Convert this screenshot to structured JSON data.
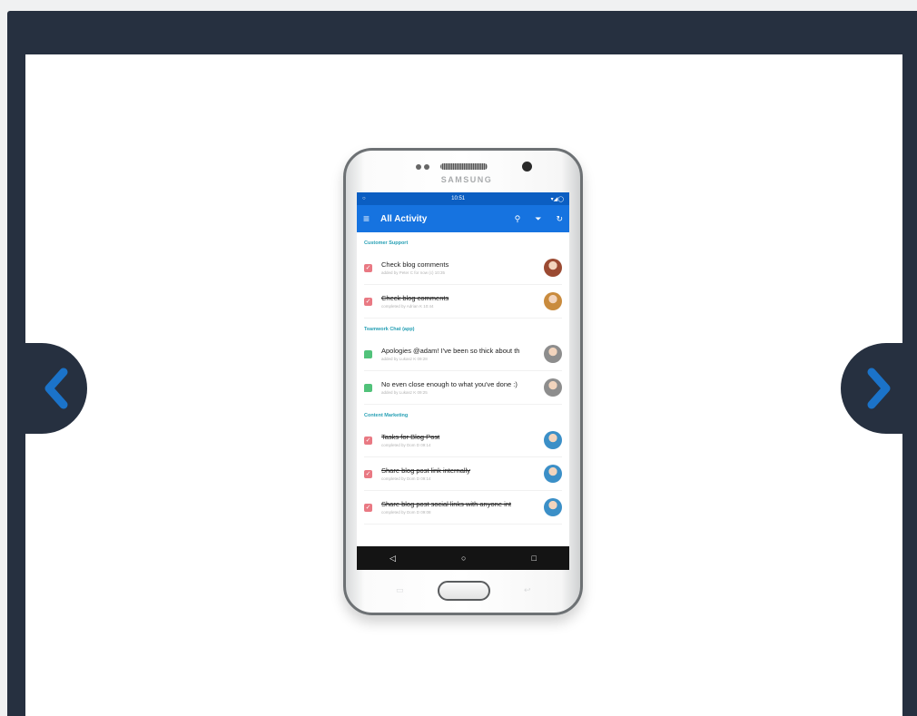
{
  "nav": {
    "prev_icon": "chevron-left-icon",
    "next_icon": "chevron-right-icon"
  },
  "colors": {
    "frame": "#263040",
    "arrow": "#1b73c9",
    "appbar": "#1673e0",
    "section": "#27a0b5"
  },
  "phone": {
    "brand": "SAMSUNG",
    "status": {
      "time": "10:51",
      "icons": "▾◢◯"
    },
    "appbar": {
      "title": "All Activity",
      "menu_icon": "≡",
      "search_icon": "⚲",
      "filter_icon": "⏷",
      "refresh_icon": "↻"
    },
    "sections": [
      {
        "title": "Customer Support",
        "items": [
          {
            "kind": "task",
            "title": "Check blog comments",
            "meta": "added by Peter C for now (c) 10:35",
            "done": false,
            "avatar_color": "#9b4a32"
          },
          {
            "kind": "task",
            "title": "Check blog comments",
            "meta": "completed by Adrian K 10:44",
            "done": true,
            "avatar_color": "#c98b3d"
          }
        ]
      },
      {
        "title": "Teamwork Chat (app)",
        "items": [
          {
            "kind": "chat",
            "title": "Apologies @adam! I've been so thick about th",
            "meta": "added by Lukasz K 09:28",
            "done": false,
            "avatar_color": "#8d8d8d"
          },
          {
            "kind": "chat",
            "title": "No even close enough to what you've done :)",
            "meta": "added by Lukasz K 09:25",
            "done": false,
            "avatar_color": "#8d8d8d"
          }
        ]
      },
      {
        "title": "Content Marketing",
        "items": [
          {
            "kind": "task",
            "title": "Tasks for Blog Post",
            "meta": "completed by Dom D 09:14",
            "done": true,
            "avatar_color": "#3b8fc7"
          },
          {
            "kind": "task",
            "title": "Share blog post link internally",
            "meta": "completed by Dom D 09:14",
            "done": true,
            "avatar_color": "#3b8fc7"
          },
          {
            "kind": "task",
            "title": "Share blog post social links with anyone int",
            "meta": "completed by Dom D 09:08",
            "done": true,
            "avatar_color": "#3b8fc7"
          }
        ]
      }
    ],
    "navbar": {
      "back": "◁",
      "home": "○",
      "recents": "□"
    }
  }
}
